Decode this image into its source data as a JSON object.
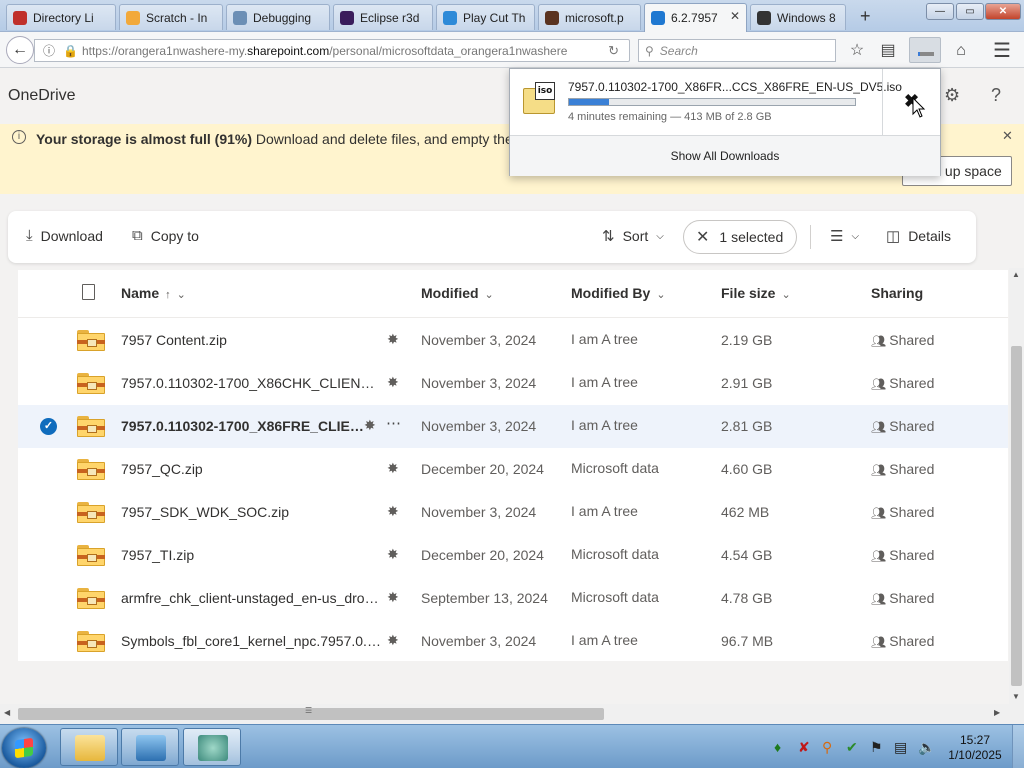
{
  "browser": {
    "tabs": [
      {
        "label": "Directory Li",
        "color": "#c0302a"
      },
      {
        "label": "Scratch - In",
        "color": "#f2a93b"
      },
      {
        "label": "Debugging",
        "color": "#6c8fb5"
      },
      {
        "label": "Eclipse r3d",
        "color": "#3b1d5c"
      },
      {
        "label": "Play Cut Th",
        "color": "#2d8ad8"
      },
      {
        "label": "microsoft.p",
        "color": "#5a3320"
      },
      {
        "label": "6.2.7957",
        "color": "#1f78d1",
        "active": true
      },
      {
        "label": "Windows 8",
        "color": "#333333"
      }
    ],
    "new_tab": "+",
    "window_controls": {
      "minimize": "—",
      "maximize": "▭",
      "close": "✕"
    },
    "url": {
      "prefix": "https://orangera1nwashere-my.",
      "host": "sharepoint.com",
      "path": "/personal/microsoftdata_orangera1nwashere"
    },
    "search_placeholder": "Search"
  },
  "onedrive": {
    "title": "OneDrive",
    "banner": {
      "bold": "Your storage is almost full (91%)",
      "text": " Download and delete files, and empty the",
      "button": "Free up space"
    },
    "commands": {
      "download": "Download",
      "copy_to": "Copy to",
      "sort": "Sort",
      "selected": "1 selected",
      "details": "Details"
    },
    "columns": {
      "name": "Name",
      "modified": "Modified",
      "modified_by": "Modified By",
      "file_size": "File size",
      "sharing": "Sharing"
    },
    "files": [
      {
        "name": "7957 Content.zip",
        "modified": "November 3, 2024",
        "by": "I am A tree",
        "size": "2.19 GB",
        "sharing": "Shared"
      },
      {
        "name": "7957.0.110302-1700_X86CHK_CLIENT_E...",
        "modified": "November 3, 2024",
        "by": "I am A tree",
        "size": "2.91 GB",
        "sharing": "Shared"
      },
      {
        "name": "7957.0.110302-1700_X86FRE_CLIEN...",
        "modified": "November 3, 2024",
        "by": "I am A tree",
        "size": "2.81 GB",
        "sharing": "Shared",
        "selected": true
      },
      {
        "name": "7957_QC.zip",
        "modified": "December 20, 2024",
        "by": "Microsoft data",
        "size": "4.60 GB",
        "sharing": "Shared"
      },
      {
        "name": "7957_SDK_WDK_SOC.zip",
        "modified": "November 3, 2024",
        "by": "I am A tree",
        "size": "462 MB",
        "sharing": "Shared"
      },
      {
        "name": "7957_TI.zip",
        "modified": "December 20, 2024",
        "by": "Microsoft data",
        "size": "4.54 GB",
        "sharing": "Shared"
      },
      {
        "name": "armfre_chk_client-unstaged_en-us_drop_n...",
        "modified": "September 13, 2024",
        "by": "Microsoft data",
        "size": "4.78 GB",
        "sharing": "Shared"
      },
      {
        "name": "Symbols_fbl_core1_kernel_npc.7957.0.110...",
        "modified": "November 3, 2024",
        "by": "I am A tree",
        "size": "96.7 MB",
        "sharing": "Shared"
      }
    ]
  },
  "download_panel": {
    "icon_label": "iso",
    "filename": "7957.0.110302-1700_X86FR...CCS_X86FRE_EN-US_DV5.iso",
    "progress": 0.14,
    "status": "4 minutes remaining — 413 MB of 2.8 GB",
    "show_all": "Show All Downloads"
  },
  "taskbar": {
    "time": "15:27",
    "date": "1/10/2025"
  }
}
